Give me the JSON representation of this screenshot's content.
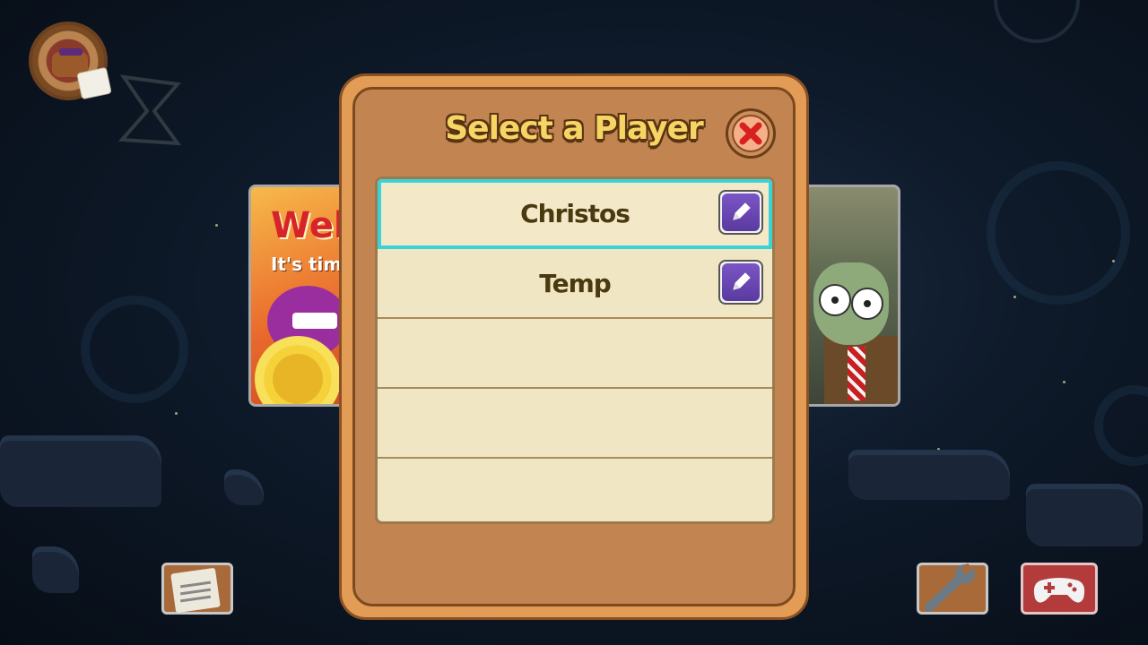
{
  "dialog": {
    "title": "Select a Player",
    "close_icon": "close-icon"
  },
  "players": [
    {
      "name": "Christos",
      "selected": true,
      "edit_icon": "pencil-icon"
    },
    {
      "name": "Temp",
      "selected": false,
      "edit_icon": "pencil-icon"
    },
    {
      "name": "",
      "selected": false
    },
    {
      "name": "",
      "selected": false
    },
    {
      "name": "",
      "selected": false
    }
  ],
  "left_card": {
    "headline": "Welc",
    "subline": "It's tim"
  },
  "bottom_left_icon": "newspaper-icon",
  "bottom_right_icons": [
    "wrench-icon",
    "game-controller-icon"
  ],
  "colors": {
    "dialog_frame": "#e39c55",
    "dialog_inner": "#c28451",
    "list_bg": "#f1e6c3",
    "selection": "#3ad4d8",
    "title": "#f6d565",
    "edit_button": "#6a46b6",
    "close_x": "#d8201e"
  }
}
